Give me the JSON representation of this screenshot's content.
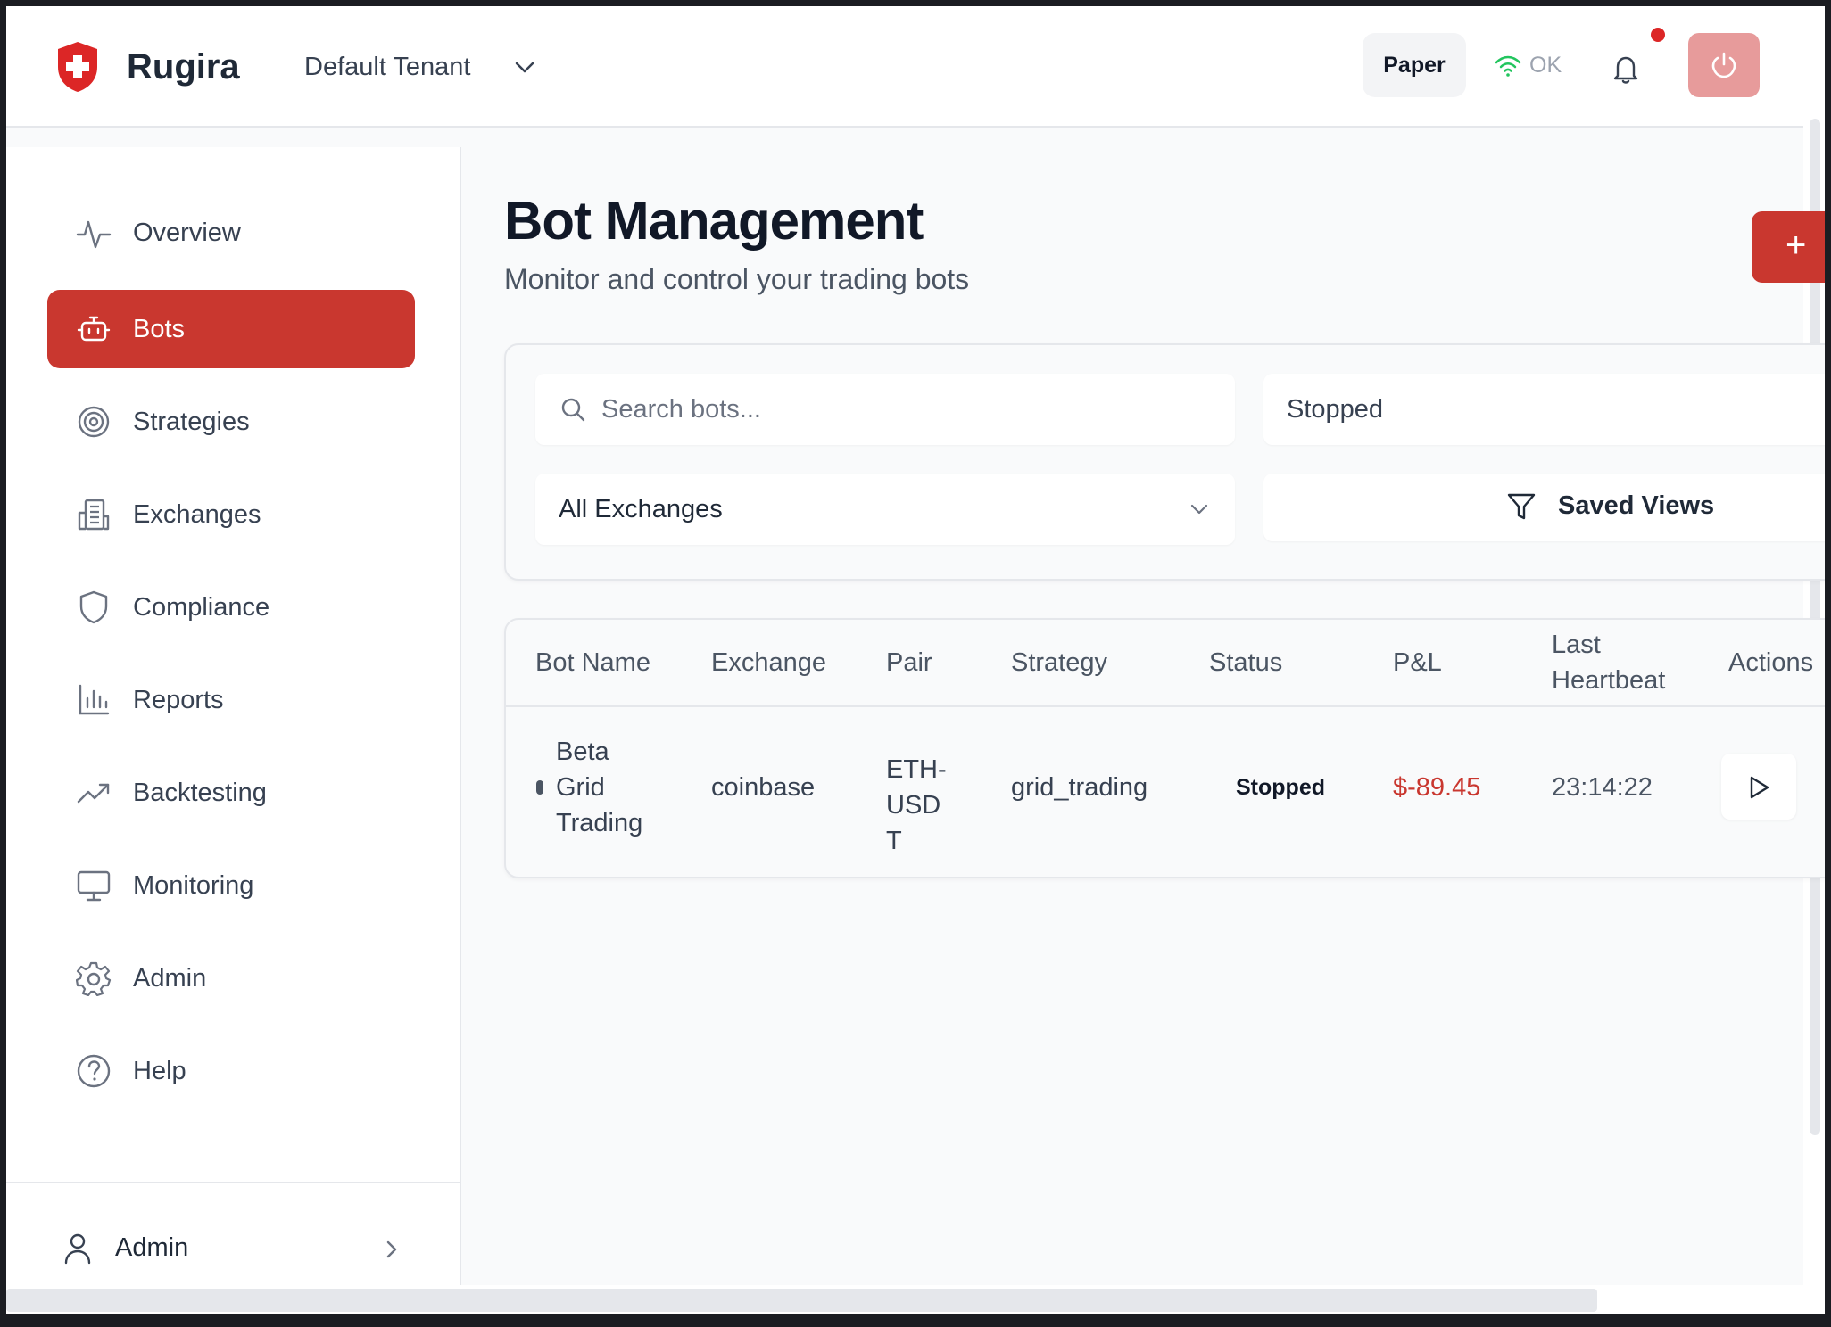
{
  "header": {
    "brand": "Rugira",
    "tenant": "Default Tenant",
    "mode_label": "Paper",
    "connection_status": "OK",
    "colors": {
      "accent": "#c9372f",
      "status_ok": "#22c55e",
      "notification": "#dc2626"
    }
  },
  "sidebar": {
    "items": [
      {
        "label": "Overview",
        "icon": "activity-icon",
        "active": false
      },
      {
        "label": "Bots",
        "icon": "bot-icon",
        "active": true
      },
      {
        "label": "Strategies",
        "icon": "target-icon",
        "active": false
      },
      {
        "label": "Exchanges",
        "icon": "building-icon",
        "active": false
      },
      {
        "label": "Compliance",
        "icon": "shield-icon",
        "active": false
      },
      {
        "label": "Reports",
        "icon": "bar-chart-icon",
        "active": false
      },
      {
        "label": "Backtesting",
        "icon": "trending-up-icon",
        "active": false
      },
      {
        "label": "Monitoring",
        "icon": "monitor-icon",
        "active": false
      },
      {
        "label": "Admin",
        "icon": "gear-icon",
        "active": false
      },
      {
        "label": "Help",
        "icon": "help-circle-icon",
        "active": false
      }
    ],
    "user": {
      "name": "Admin"
    }
  },
  "main": {
    "title": "Bot Management",
    "subtitle": "Monitor and control your trading bots",
    "new_bot_label": "+",
    "filters": {
      "search_placeholder": "Search bots...",
      "search_value": "",
      "status_value": "Stopped",
      "exchange_value": "All Exchanges",
      "saved_views_label": "Saved Views"
    },
    "table": {
      "columns": [
        "Bot Name",
        "Exchange",
        "Pair",
        "Strategy",
        "Status",
        "P&L",
        "Last Heartbeat",
        "Actions"
      ],
      "rows": [
        {
          "bot_name": "Beta Grid Trading",
          "exchange": "coinbase",
          "pair": "ETH-USDT",
          "strategy": "grid_trading",
          "status": "Stopped",
          "pnl": "$-89.45",
          "last_heartbeat": "23:14:22",
          "action_icon": "play-icon"
        }
      ]
    }
  }
}
